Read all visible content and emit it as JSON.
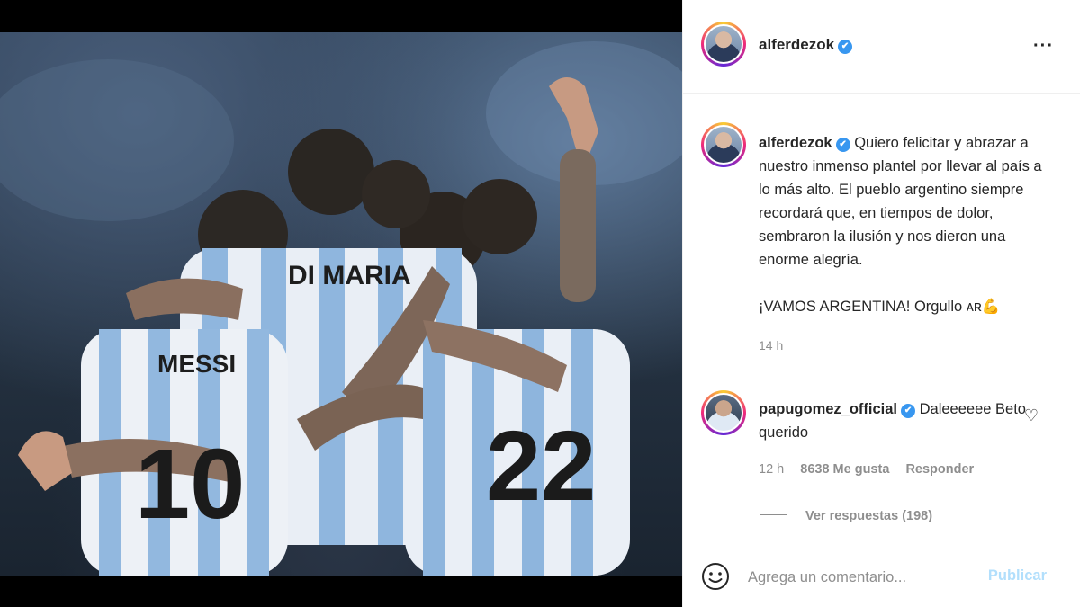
{
  "post": {
    "author": "alferdezok",
    "verified_mark": "✔",
    "more_label": "···",
    "caption_author": "alferdezok",
    "caption_text": "Quiero felicitar y abrazar a nuestro inmenso plantel por llevar al país a lo más alto. El pueblo argentino siempre recordará que, en tiempos de dolor, sembraron la ilusión y nos dieron una enorme alegría.",
    "caption_text2": "¡VAMOS ARGENTINA! Orgullo ᴀʀ💪",
    "caption_time": "14 h",
    "photo": {
      "jersey_names": [
        "DI MARIA",
        "MESSI"
      ],
      "jersey_numbers": [
        "10",
        "22"
      ]
    }
  },
  "comment": {
    "author": "papugomez_official",
    "text": "Daleeeeee Beto querido",
    "time": "12 h",
    "likes": "8638 Me gusta",
    "reply": "Responder",
    "view_replies": "Ver respuestas (198)",
    "like_icon": "heart-icon"
  },
  "composer": {
    "placeholder": "Agrega un comentario...",
    "publish": "Publicar",
    "emoji_icon": "smiley-icon"
  },
  "colors": {
    "verified": "#3897f0",
    "publish_disabled": "#b2dffc",
    "meta_gray": "#8e8e8e"
  }
}
